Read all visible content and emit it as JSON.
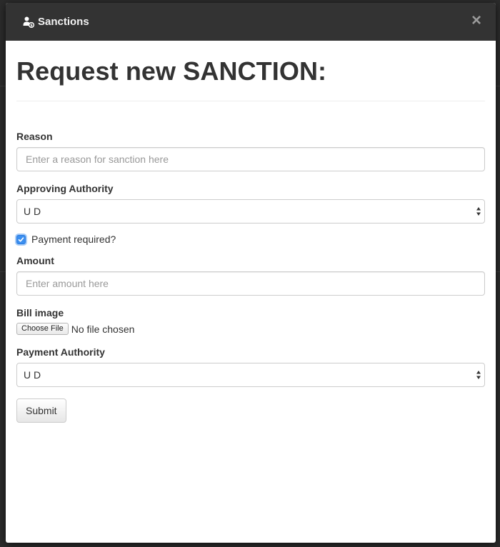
{
  "modal": {
    "title": "Sanctions",
    "close_glyph": "×"
  },
  "page": {
    "heading": "Request new SANCTION:"
  },
  "form": {
    "reason": {
      "label": "Reason",
      "placeholder": "Enter a reason for sanction here",
      "value": ""
    },
    "approving_authority": {
      "label": "Approving Authority",
      "selected": "U D"
    },
    "payment_required": {
      "label": "Payment required?",
      "checked": true
    },
    "amount": {
      "label": "Amount",
      "placeholder": "Enter amount here",
      "value": ""
    },
    "bill_image": {
      "label": "Bill image",
      "button_label": "Choose File",
      "status": "No file chosen"
    },
    "payment_authority": {
      "label": "Payment Authority",
      "selected": "U D"
    },
    "submit_label": "Submit"
  },
  "icons": {
    "header": "user-money-icon",
    "close": "close-icon",
    "select_arrows": "select-arrows-icon",
    "check": "checkmark-icon"
  },
  "colors": {
    "header_bg": "#333333",
    "checkbox_accent": "#3b8ff0",
    "backdrop": "#2b2b2b"
  }
}
